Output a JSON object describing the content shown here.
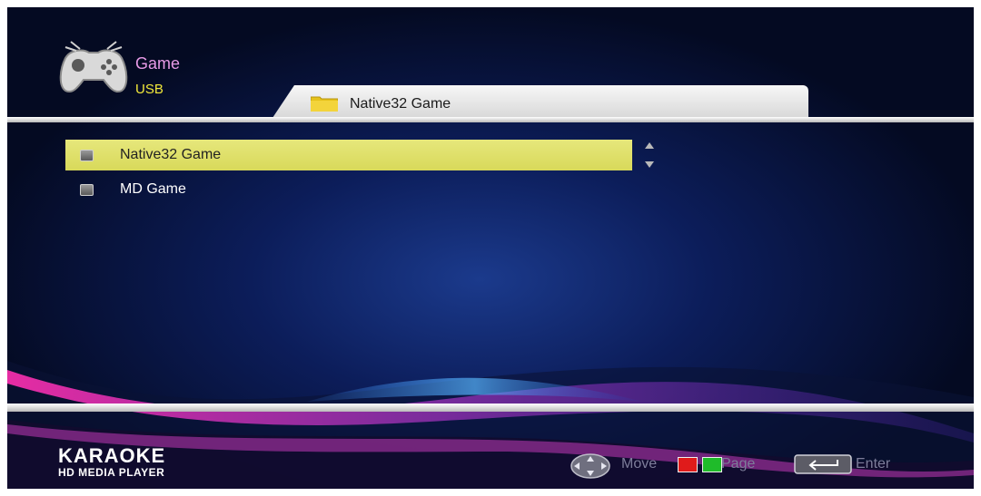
{
  "header": {
    "title": "Game",
    "subtitle": "USB",
    "icon": "gamepad-icon"
  },
  "tab": {
    "label": "Native32 Game",
    "icon": "folder-icon"
  },
  "list": {
    "items": [
      {
        "label": "Native32 Game",
        "selected": true
      },
      {
        "label": "MD Game",
        "selected": false
      }
    ]
  },
  "footer": {
    "brand": "KARAOKE",
    "brand_sub": "HD MEDIA PLAYER",
    "hints": {
      "move": "Move",
      "page": "Page",
      "enter": "Enter"
    },
    "colors": {
      "red_key": "#e01b1b",
      "green_key": "#1fbb2a"
    }
  }
}
